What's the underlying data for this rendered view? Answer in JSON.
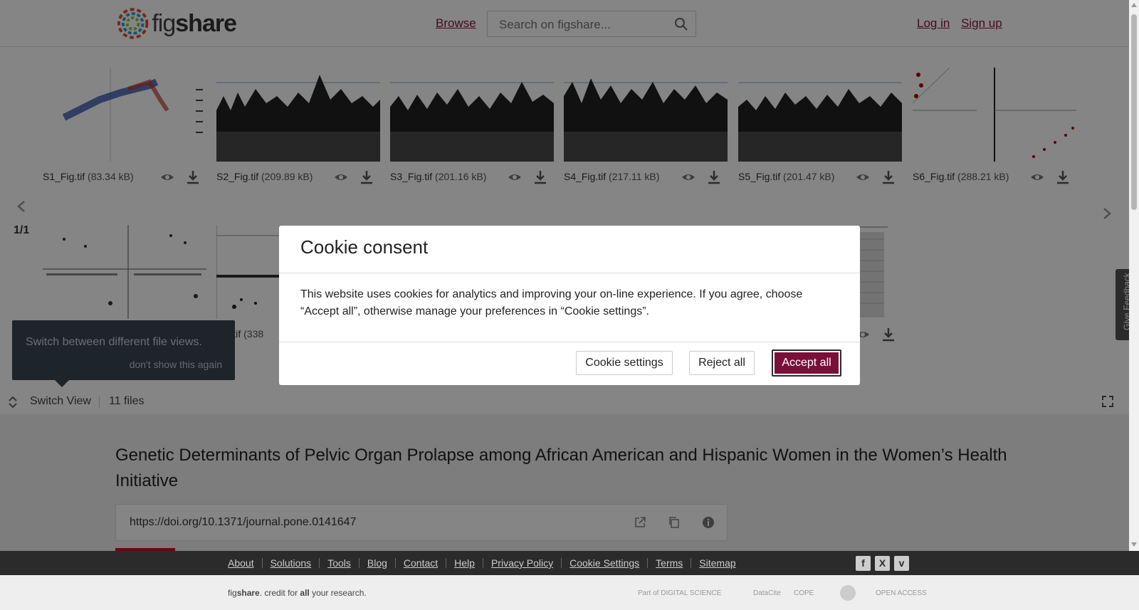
{
  "header": {
    "logo_text_light": "fig",
    "logo_text_bold": "share",
    "browse": "Browse",
    "search_placeholder": "Search on figshare...",
    "login": "Log in",
    "signup": "Sign up"
  },
  "viewer": {
    "files": [
      {
        "name": "S1_Fig.tif",
        "size": "(83.34 kB)"
      },
      {
        "name": "S2_Fig.tif",
        "size": "(209.89 kB)"
      },
      {
        "name": "S3_Fig.tif",
        "size": "(201.16 kB)"
      },
      {
        "name": "S4_Fig.tif",
        "size": "(217.11 kB)"
      },
      {
        "name": "S5_Fig.tif",
        "size": "(201.47 kB)"
      },
      {
        "name": "S6_Fig.tif",
        "size": "(288.21 kB)"
      },
      {
        "name": "",
        "size": ""
      },
      {
        "name": "Fig.tif",
        "size": "(338"
      },
      {
        "name": "",
        "size": ""
      },
      {
        "name": "",
        "size": ""
      },
      {
        "name": "",
        "size": ""
      }
    ],
    "pager": "1/1",
    "tooltip_text": "Switch between different file views.",
    "tooltip_dismiss": "don't show this again",
    "switch_view": "Switch View",
    "files_count": "11 files"
  },
  "article": {
    "title": "Genetic Determinants of Pelvic Organ Prolapse among African American and Hispanic Women in the Women’s Health Initiative",
    "doi": "https://doi.org/10.1371/journal.pone.0141647"
  },
  "cookie_modal": {
    "title": "Cookie consent",
    "body": "This website uses cookies for analytics and improving your on-line experience. If you agree, choose “Accept all”, otherwise manage your preferences in “Cookie settings”.",
    "settings": "Cookie settings",
    "reject": "Reject all",
    "accept": "Accept all"
  },
  "feedback": "Give Feedback",
  "footer": {
    "links": [
      "About",
      "Solutions",
      "Tools",
      "Blog",
      "Contact",
      "Help",
      "Privacy Policy",
      "Cookie Settings",
      "Terms",
      "Sitemap"
    ],
    "credit_prefix_light": "fig",
    "credit_prefix_bold": "share",
    "credit_mid": ". credit for ",
    "credit_bold": "all",
    "credit_end": " your research.",
    "partners": [
      "Part of DIGITAL SCIENCE",
      "DataCite",
      "COPE",
      "",
      "OPEN ACCESS"
    ],
    "social_icons": [
      "facebook-icon",
      "x-icon",
      "vimeo-icon"
    ]
  },
  "colors": {
    "brand": "#8a1538",
    "accept_button": "#7a1039",
    "tooltip_bg": "#394652"
  }
}
